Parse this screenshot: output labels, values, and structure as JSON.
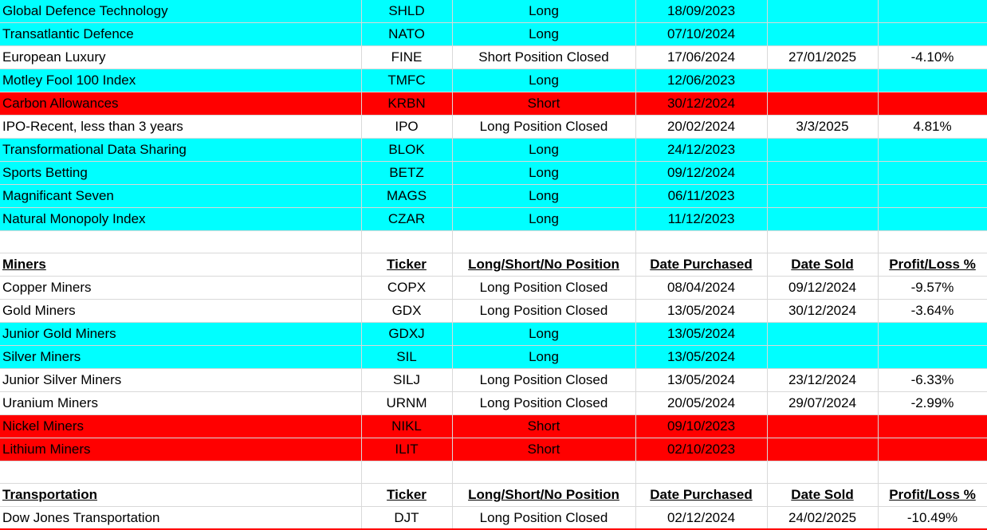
{
  "headers": {
    "ticker": "Ticker",
    "position": "Long/Short/No Position",
    "date_purchased": "Date Purchased",
    "date_sold": "Date Sold",
    "profit_loss": "Profit/Loss %"
  },
  "colors": {
    "long": "#00ffff",
    "short": "#ff0000",
    "closed": "#ffffff"
  },
  "rows": [
    {
      "kind": "long",
      "name": "Global Defence Technology",
      "ticker": "SHLD",
      "position": "Long",
      "purchased": "18/09/2023",
      "sold": "",
      "pl": ""
    },
    {
      "kind": "long",
      "name": "Transatlantic Defence",
      "ticker": "NATO",
      "position": "Long",
      "purchased": "07/10/2024",
      "sold": "",
      "pl": ""
    },
    {
      "kind": "closed",
      "name": "European Luxury",
      "ticker": "FINE",
      "position": "Short Position Closed",
      "purchased": "17/06/2024",
      "sold": "27/01/2025",
      "pl": "-4.10%"
    },
    {
      "kind": "long",
      "name": "Motley Fool 100 Index",
      "ticker": "TMFC",
      "position": "Long",
      "purchased": "12/06/2023",
      "sold": "",
      "pl": ""
    },
    {
      "kind": "short",
      "name": "Carbon Allowances",
      "ticker": "KRBN",
      "position": "Short",
      "purchased": "30/12/2024",
      "sold": "",
      "pl": ""
    },
    {
      "kind": "closed",
      "name": "IPO-Recent, less than 3 years",
      "ticker": "IPO",
      "position": "Long Position Closed",
      "purchased": "20/02/2024",
      "sold": "3/3/2025",
      "pl": "4.81%"
    },
    {
      "kind": "long",
      "name": "Transformational Data Sharing",
      "ticker": "BLOK",
      "position": "Long",
      "purchased": "24/12/2023",
      "sold": "",
      "pl": ""
    },
    {
      "kind": "long",
      "name": "Sports Betting",
      "ticker": "BETZ",
      "position": "Long",
      "purchased": "09/12/2024",
      "sold": "",
      "pl": ""
    },
    {
      "kind": "long",
      "name": "Magnificant Seven",
      "ticker": "MAGS",
      "position": "Long",
      "purchased": "06/11/2023",
      "sold": "",
      "pl": ""
    },
    {
      "kind": "long",
      "name": "Natural Monopoly Index",
      "ticker": "CZAR",
      "position": "Long",
      "purchased": "11/12/2023",
      "sold": "",
      "pl": ""
    },
    {
      "kind": "blank",
      "name": "",
      "ticker": "",
      "position": "",
      "purchased": "",
      "sold": "",
      "pl": ""
    },
    {
      "kind": "header",
      "name": "Miners",
      "ticker": "Ticker",
      "position": "Long/Short/No Position",
      "purchased": "Date Purchased",
      "sold": "Date Sold",
      "pl": "Profit/Loss %"
    },
    {
      "kind": "closed",
      "name": "Copper Miners",
      "ticker": "COPX",
      "position": "Long Position Closed",
      "purchased": "08/04/2024",
      "sold": "09/12/2024",
      "pl": "-9.57%"
    },
    {
      "kind": "closed",
      "name": "Gold Miners",
      "ticker": "GDX",
      "position": "Long Position Closed",
      "purchased": "13/05/2024",
      "sold": "30/12/2024",
      "pl": "-3.64%"
    },
    {
      "kind": "long",
      "name": "Junior Gold Miners",
      "ticker": "GDXJ",
      "position": "Long",
      "purchased": "13/05/2024",
      "sold": "",
      "pl": ""
    },
    {
      "kind": "long",
      "name": "Silver Miners",
      "ticker": "SIL",
      "position": "Long",
      "purchased": "13/05/2024",
      "sold": "",
      "pl": ""
    },
    {
      "kind": "closed",
      "name": "Junior Silver Miners",
      "ticker": "SILJ",
      "position": "Long Position Closed",
      "purchased": "13/05/2024",
      "sold": "23/12/2024",
      "pl": "-6.33%"
    },
    {
      "kind": "closed",
      "name": "Uranium Miners",
      "ticker": "URNM",
      "position": "Long Position Closed",
      "purchased": "20/05/2024",
      "sold": "29/07/2024",
      "pl": "-2.99%"
    },
    {
      "kind": "short",
      "name": "Nickel Miners",
      "ticker": "NIKL",
      "position": "Short",
      "purchased": "09/10/2023",
      "sold": "",
      "pl": ""
    },
    {
      "kind": "short",
      "name": "Lithium Miners",
      "ticker": "ILIT",
      "position": "Short",
      "purchased": "02/10/2023",
      "sold": "",
      "pl": ""
    },
    {
      "kind": "blank",
      "name": "",
      "ticker": "",
      "position": "",
      "purchased": "",
      "sold": "",
      "pl": ""
    },
    {
      "kind": "header",
      "name": "Transportation",
      "ticker": "Ticker",
      "position": "Long/Short/No Position",
      "purchased": "Date Purchased",
      "sold": "Date Sold",
      "pl": "Profit/Loss %"
    },
    {
      "kind": "closed",
      "name": "Dow Jones Transportation",
      "ticker": "DJT",
      "position": "Long Position Closed",
      "purchased": "02/12/2024",
      "sold": "24/02/2025",
      "pl": "-10.49%"
    }
  ]
}
